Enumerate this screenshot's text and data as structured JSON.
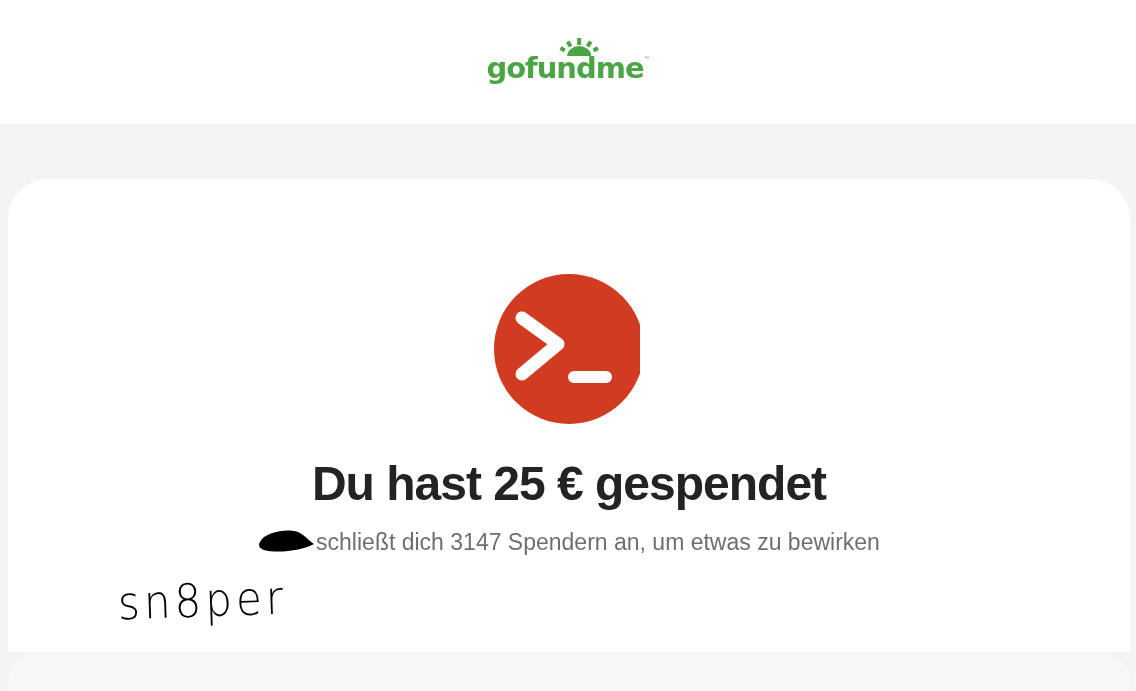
{
  "header": {
    "logo": {
      "text": "gofundme",
      "trademark": "™"
    }
  },
  "confirmation": {
    "title": "Du hast 25 € gespendet",
    "subtitle": "schließt dich 3147 Spendern an, um etwas zu bewirken"
  },
  "annotation": {
    "text": "sn8per"
  }
}
